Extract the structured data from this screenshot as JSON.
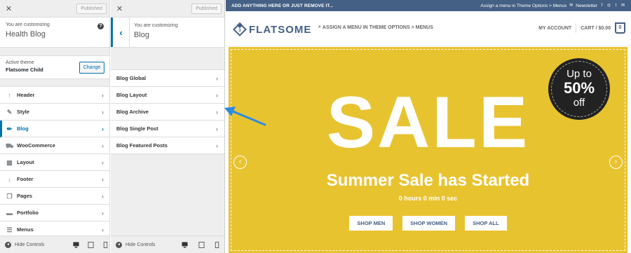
{
  "panel1": {
    "publish_label": "Published",
    "customizing_label": "You are customizing",
    "site_title": "Health Blog",
    "help_glyph": "?",
    "active_theme_label": "Active theme",
    "active_theme_name": "Flatsome Child",
    "change_label": "Change",
    "items": [
      {
        "label": "Header",
        "icon": "arrow-up-icon",
        "glyph": "↑"
      },
      {
        "label": "Style",
        "icon": "brush-icon",
        "glyph": "✎"
      },
      {
        "label": "Blog",
        "icon": "edit-icon",
        "glyph": "✏"
      },
      {
        "label": "WooCommerce",
        "icon": "cart-icon",
        "glyph": "⛟"
      },
      {
        "label": "Layout",
        "icon": "layout-icon",
        "glyph": "▦"
      },
      {
        "label": "Footer",
        "icon": "arrow-down-icon",
        "glyph": "↓"
      },
      {
        "label": "Pages",
        "icon": "pages-icon",
        "glyph": "❐"
      },
      {
        "label": "Portfolio",
        "icon": "portfolio-icon",
        "glyph": "▬"
      },
      {
        "label": "Menus",
        "icon": "menu-icon",
        "glyph": "☰"
      }
    ],
    "active_item": "Blog",
    "hide_controls_label": "Hide Controls"
  },
  "panel2": {
    "publish_label": "Published",
    "customizing_label": "You are customizing",
    "section_title": "Blog",
    "items": [
      "Blog Global",
      "Blog Layout",
      "Blog Archive",
      "Blog Single Post",
      "Blog Featured Posts"
    ],
    "hide_controls_label": "Hide Controls"
  },
  "preview": {
    "topbar_text": "ADD ANYTHING HERE OR JUST REMOVE IT...",
    "topbar_menu": "Assign a menu in Theme Options > Menus",
    "newsletter_label": "Newsletter",
    "logo_text": "FLATSOME",
    "nav_text": "ASSIGN A MENU IN THEME OPTIONS > MENUS",
    "account_label": "MY ACCOUNT",
    "cart_label": "CART / $0.00",
    "cart_count": "0",
    "badge_line1": "Up to",
    "badge_line2": "50%",
    "badge_line3": "off",
    "headline": "SALE",
    "subheadline": "Summer Sale has Started",
    "countdown": "0 hours  0 min  0 sec",
    "buttons": [
      "SHOP MEN",
      "SHOP WOMEN",
      "SHOP ALL"
    ],
    "banner_color": "#e8c330",
    "brand_color": "#446084",
    "accent_color": "#0073aa"
  }
}
